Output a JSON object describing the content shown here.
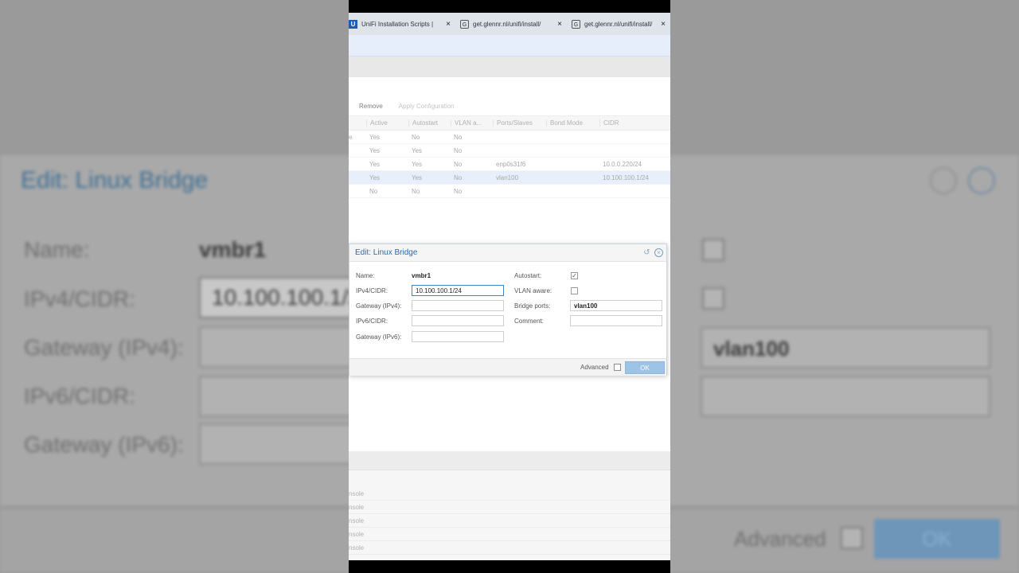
{
  "tabs": [
    {
      "icon": "U",
      "title": "UniFi Installation Scripts |",
      "close": "×"
    },
    {
      "icon": "G",
      "title": "get.glennr.nl/unifi/install/",
      "close": "×"
    },
    {
      "icon": "G",
      "title": "get.glennr.nl/unifi/install/",
      "close": "×"
    }
  ],
  "toolbar": {
    "remove_label": "Remove",
    "apply_label": "Apply Configuration"
  },
  "grid": {
    "columns": [
      "Active",
      "Autostart",
      "VLAN a...",
      "Ports/Slaves",
      "Bond Mode",
      "CIDR"
    ],
    "rows": [
      {
        "lead": "e",
        "active": "Yes",
        "autostart": "No",
        "vlan": "No",
        "ports": "",
        "bond": "",
        "cidr": ""
      },
      {
        "lead": "",
        "active": "Yes",
        "autostart": "Yes",
        "vlan": "No",
        "ports": "",
        "bond": "",
        "cidr": ""
      },
      {
        "lead": "",
        "active": "Yes",
        "autostart": "Yes",
        "vlan": "No",
        "ports": "enp0s31f6",
        "bond": "",
        "cidr": "10.0.0.220/24"
      },
      {
        "lead": "",
        "active": "Yes",
        "autostart": "Yes",
        "vlan": "No",
        "ports": "vlan100",
        "bond": "",
        "cidr": "10.100.100.1/24"
      },
      {
        "lead": "",
        "active": "No",
        "autostart": "No",
        "vlan": "No",
        "ports": "",
        "bond": "",
        "cidr": ""
      }
    ]
  },
  "lower_rows": [
    "nsole",
    "nsole",
    "nsole",
    "nsole",
    "nsole"
  ],
  "dialog": {
    "title": "Edit: Linux Bridge",
    "name_label": "Name:",
    "name_value": "vmbr1",
    "ipv4_label": "IPv4/CIDR:",
    "ipv4_value": "10.100.100.1/24",
    "gw4_label": "Gateway (IPv4):",
    "ipv6_label": "IPv6/CIDR:",
    "gw6_label": "Gateway (IPv6):",
    "autostart_label": "Autostart:",
    "vlan_label": "VLAN aware:",
    "bridge_ports_label": "Bridge ports:",
    "bridge_ports_value": "vlan100",
    "comment_label": "Comment:",
    "advanced_label": "Advanced",
    "ok_label": "OK",
    "checkmark": "✓",
    "reset_icon": "↺",
    "close_icon": "×"
  },
  "colors": {
    "accent": "#2a6aa3",
    "ok_button": "#9dc3e6",
    "selection": "#e7f0fa"
  }
}
